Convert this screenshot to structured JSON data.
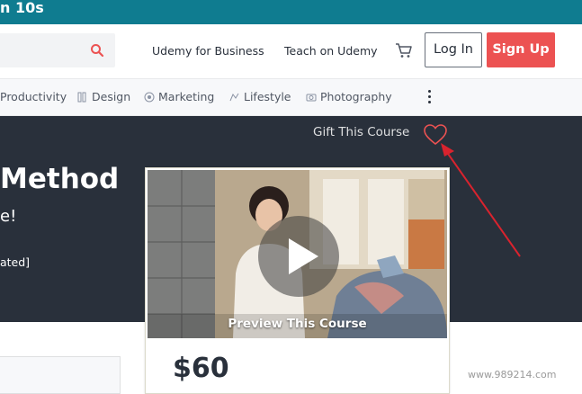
{
  "banner": {
    "text": "n 10s"
  },
  "header": {
    "links": [
      "Udemy for Business",
      "Teach on Udemy"
    ],
    "login_label": "Log In",
    "signup_label": "Sign Up"
  },
  "categories": [
    {
      "label": "Productivity",
      "icon": ""
    },
    {
      "label": "Design",
      "icon": "design-icon"
    },
    {
      "label": "Marketing",
      "icon": "marketing-icon"
    },
    {
      "label": "Lifestyle",
      "icon": "lifestyle-icon"
    },
    {
      "label": "Photography",
      "icon": "camera-icon"
    }
  ],
  "hero": {
    "gift_label": "Gift This Course",
    "title": "Method",
    "subtitle": "e!",
    "meta": "ated]"
  },
  "course_card": {
    "preview_label": "Preview This Course",
    "price": "$60"
  },
  "watermark": "www.989214.com",
  "colors": {
    "banner": "#0f7c90",
    "signup": "#ec5252",
    "hero_bg": "#29303b",
    "arrow": "#d9232e"
  }
}
